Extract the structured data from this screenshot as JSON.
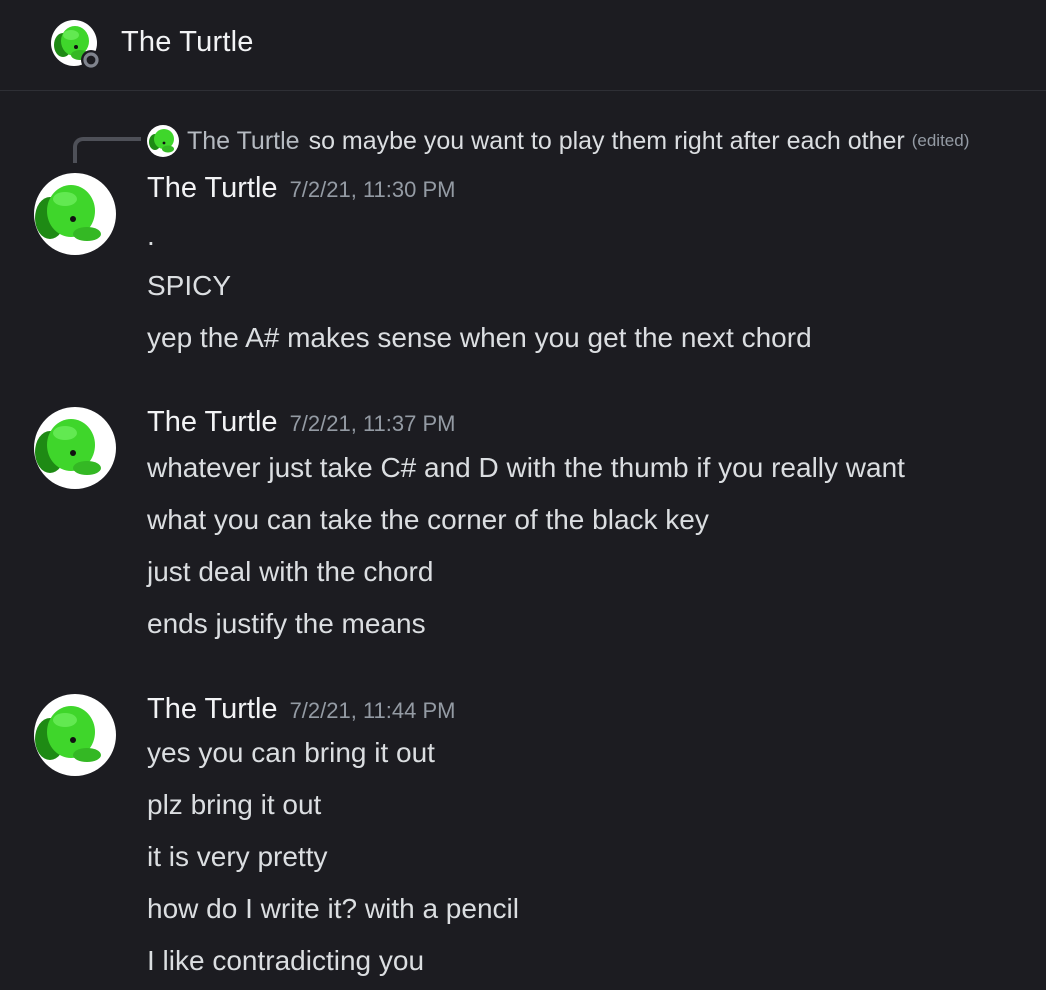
{
  "header": {
    "title": "The Turtle",
    "avatar_icon": "turtle-avatar-icon",
    "status_icon": "offline-status-icon"
  },
  "reply": {
    "author": "The Turtle",
    "text": "so maybe you want to play them right after each other",
    "edited": "(edited)"
  },
  "messages": [
    {
      "author": "The Turtle",
      "timestamp": "7/2/21, 11:30 PM",
      "lines": [
        ".",
        "SPICY",
        "yep the A# makes sense when you get the next chord"
      ]
    },
    {
      "author": "The Turtle",
      "timestamp": "7/2/21, 11:37 PM",
      "lines": [
        "whatever just take C# and D with the thumb if you really want",
        "what you can take the corner of the black key",
        "just deal with the chord",
        "ends justify the means"
      ]
    },
    {
      "author": "The Turtle",
      "timestamp": "7/2/21, 11:44 PM",
      "lines": [
        "yes you can bring it out",
        "plz bring it out",
        "it is very pretty",
        "how do I write it? with a pencil",
        "I like contradicting you"
      ]
    }
  ],
  "colors": {
    "background": "#1c1c21",
    "turtle_green": "#3fd62b",
    "text": "#dbdee1",
    "muted": "#949ba4"
  }
}
